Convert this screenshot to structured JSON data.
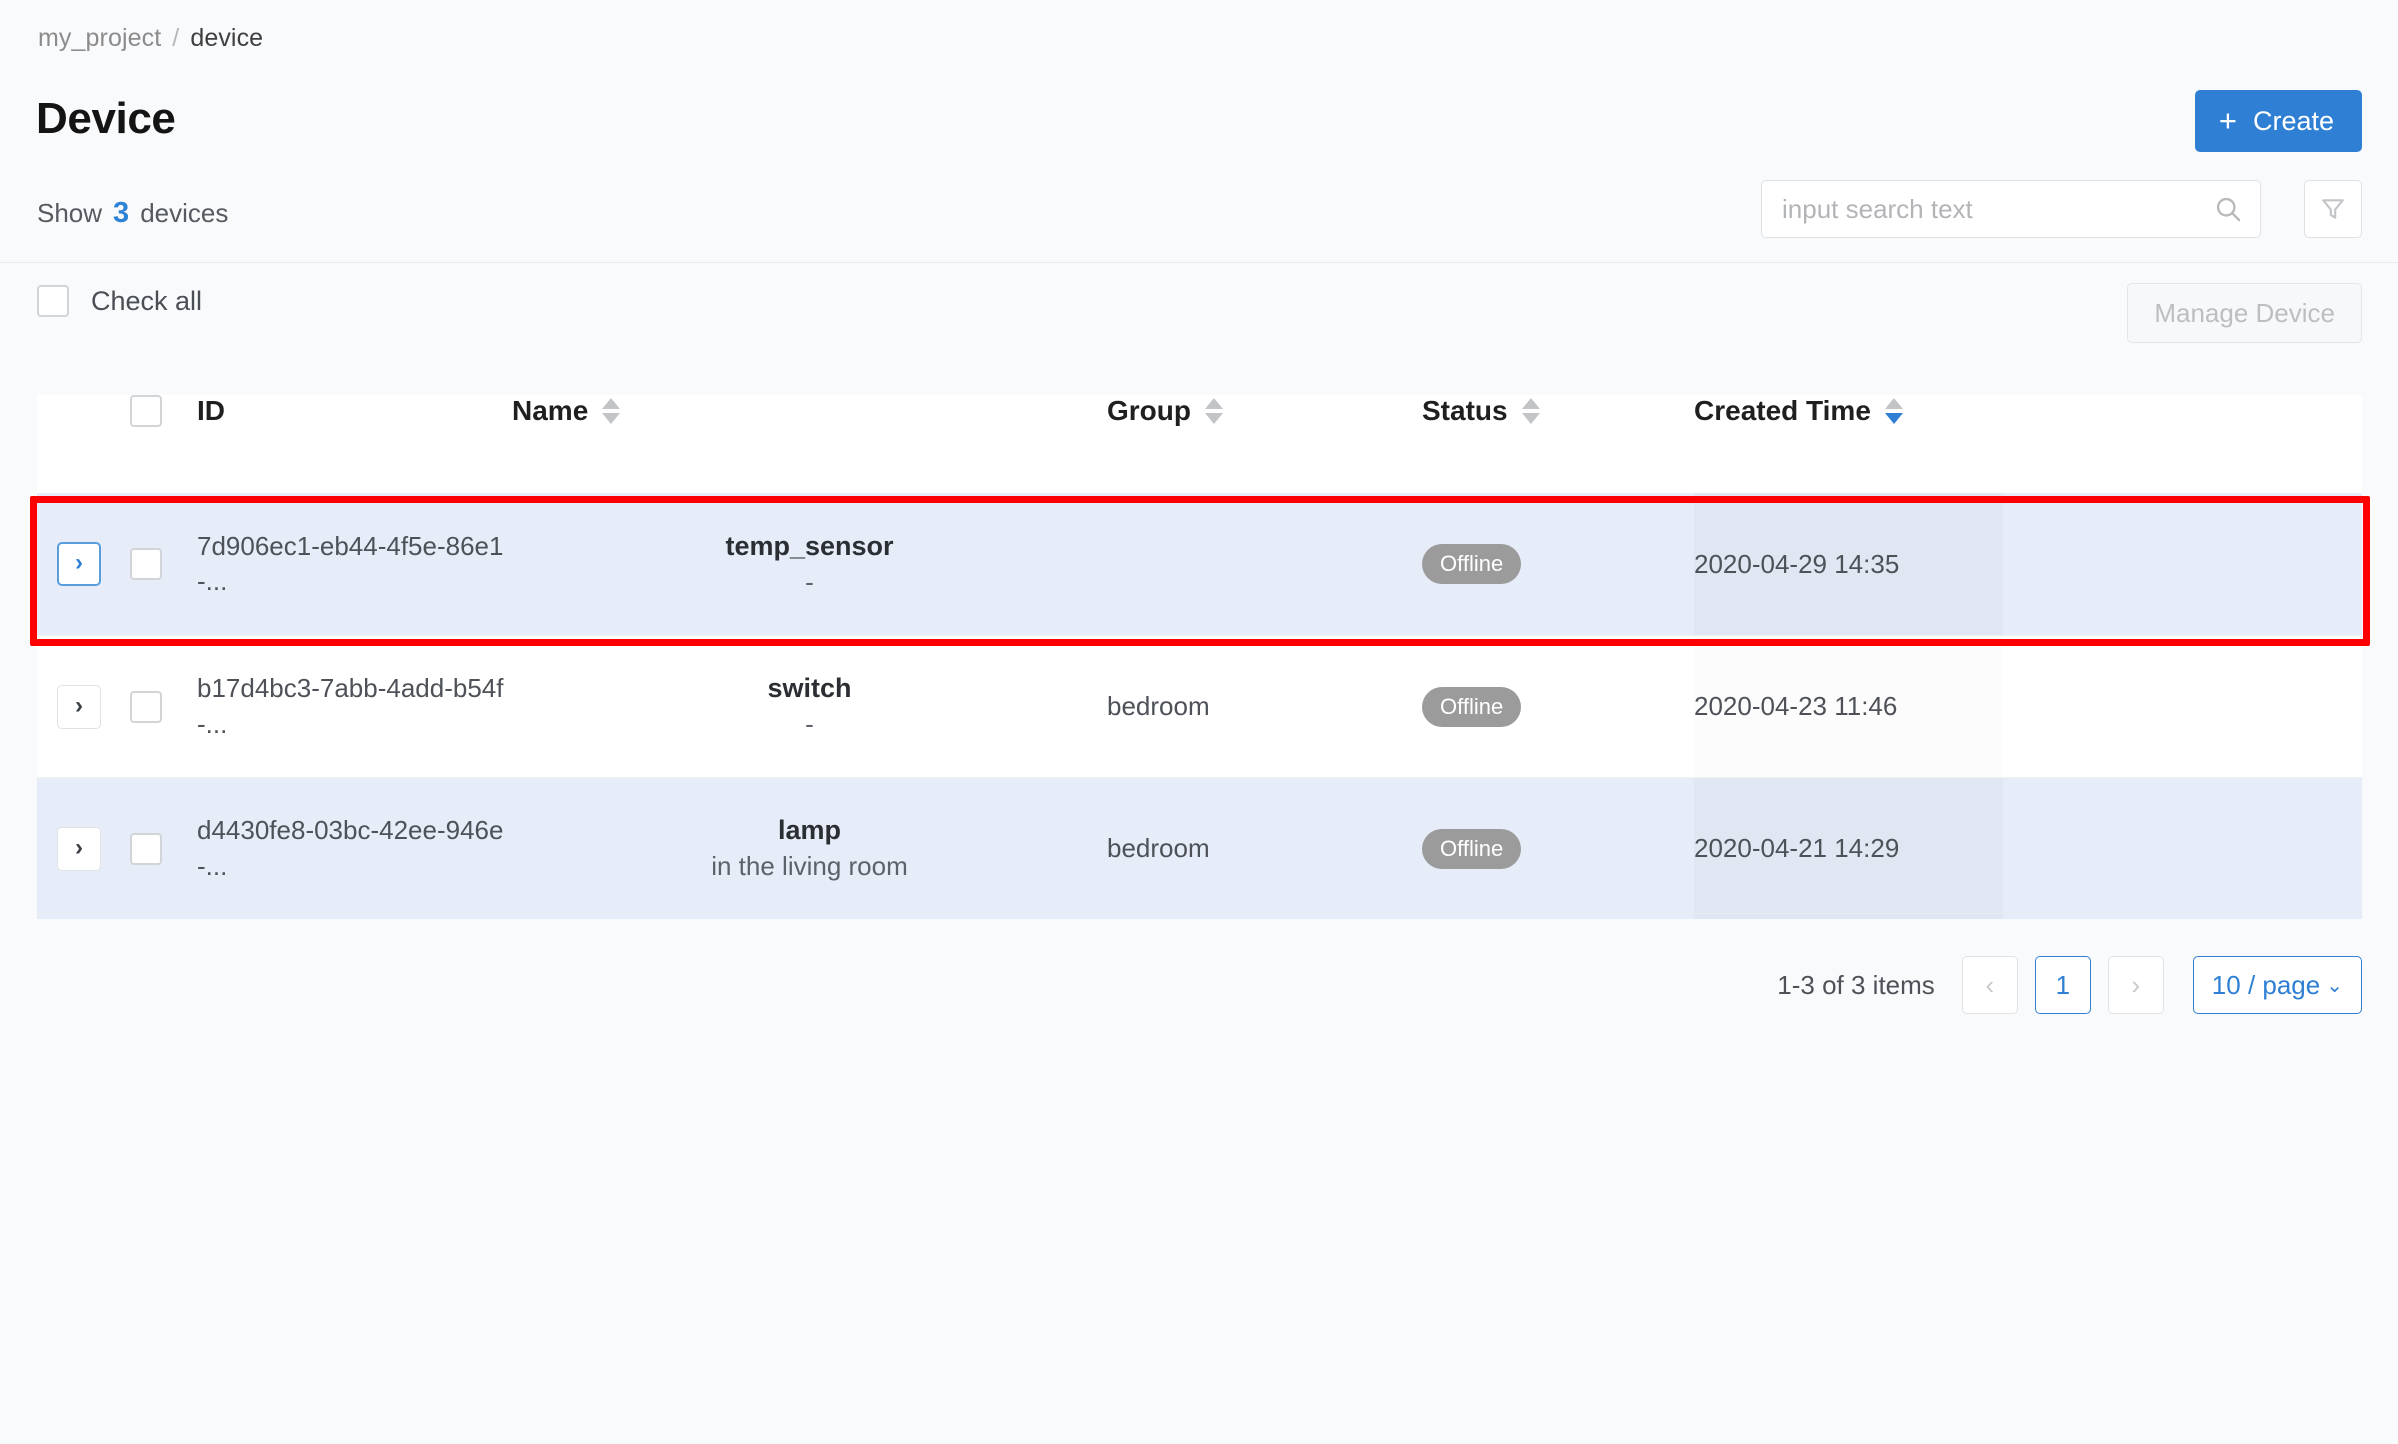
{
  "breadcrumb": {
    "parent": "my_project",
    "separator": "/",
    "current": "device"
  },
  "header": {
    "title": "Device",
    "show_prefix": "Show",
    "device_count": "3",
    "show_suffix": "devices",
    "create_label": "Create",
    "create_icon": "plus-icon",
    "create_color": "#2f80d4"
  },
  "search": {
    "value": "",
    "placeholder": "input search text",
    "icon": "search-icon",
    "filter_icon": "filter-icon"
  },
  "toolbar": {
    "check_all_label": "Check all",
    "manage_device_label": "Manage Device"
  },
  "table": {
    "columns": [
      {
        "key": "expand",
        "label": "",
        "sortable": false
      },
      {
        "key": "select",
        "label": "",
        "sortable": false
      },
      {
        "key": "id",
        "label": "ID",
        "sortable": false
      },
      {
        "key": "name",
        "label": "Name",
        "sortable": true,
        "sort": "none"
      },
      {
        "key": "group",
        "label": "Group",
        "sortable": true,
        "sort": "none"
      },
      {
        "key": "status",
        "label": "Status",
        "sortable": true,
        "sort": "none"
      },
      {
        "key": "created_time",
        "label": "Created Time",
        "sortable": true,
        "sort": "desc"
      },
      {
        "key": "actions",
        "label": "",
        "sortable": false
      }
    ],
    "rows": [
      {
        "id": "7d906ec1-eb44-4f5e-86e1-...",
        "name": "temp_sensor",
        "description": "-",
        "group": "",
        "status": "Offline",
        "created_time": "2020-04-29 14:35",
        "selected": true,
        "highlighted": true,
        "expand_focused": true
      },
      {
        "id": "b17d4bc3-7abb-4add-b54f-...",
        "name": "switch",
        "description": "-",
        "group": "bedroom",
        "status": "Offline",
        "created_time": "2020-04-23 11:46",
        "selected": false,
        "highlighted": false,
        "expand_focused": false
      },
      {
        "id": "d4430fe8-03bc-42ee-946e-...",
        "name": "lamp",
        "description": "in the living room",
        "group": "bedroom",
        "status": "Offline",
        "created_time": "2020-04-21 14:29",
        "selected": true,
        "highlighted": false,
        "expand_focused": false
      }
    ]
  },
  "pagination": {
    "total_text": "1-3 of 3 items",
    "prev_icon": "chevron-left-icon",
    "next_icon": "chevron-right-icon",
    "current_page": "1",
    "page_size_label": "10 / page",
    "page_size_icon": "chevron-down-icon"
  },
  "colors": {
    "accent": "#2f80d4",
    "selected_row": "#e6edf8",
    "status_badge": "#9b9b9b",
    "highlight_outline": "#fe0000",
    "page_background": "#f9fafc"
  }
}
